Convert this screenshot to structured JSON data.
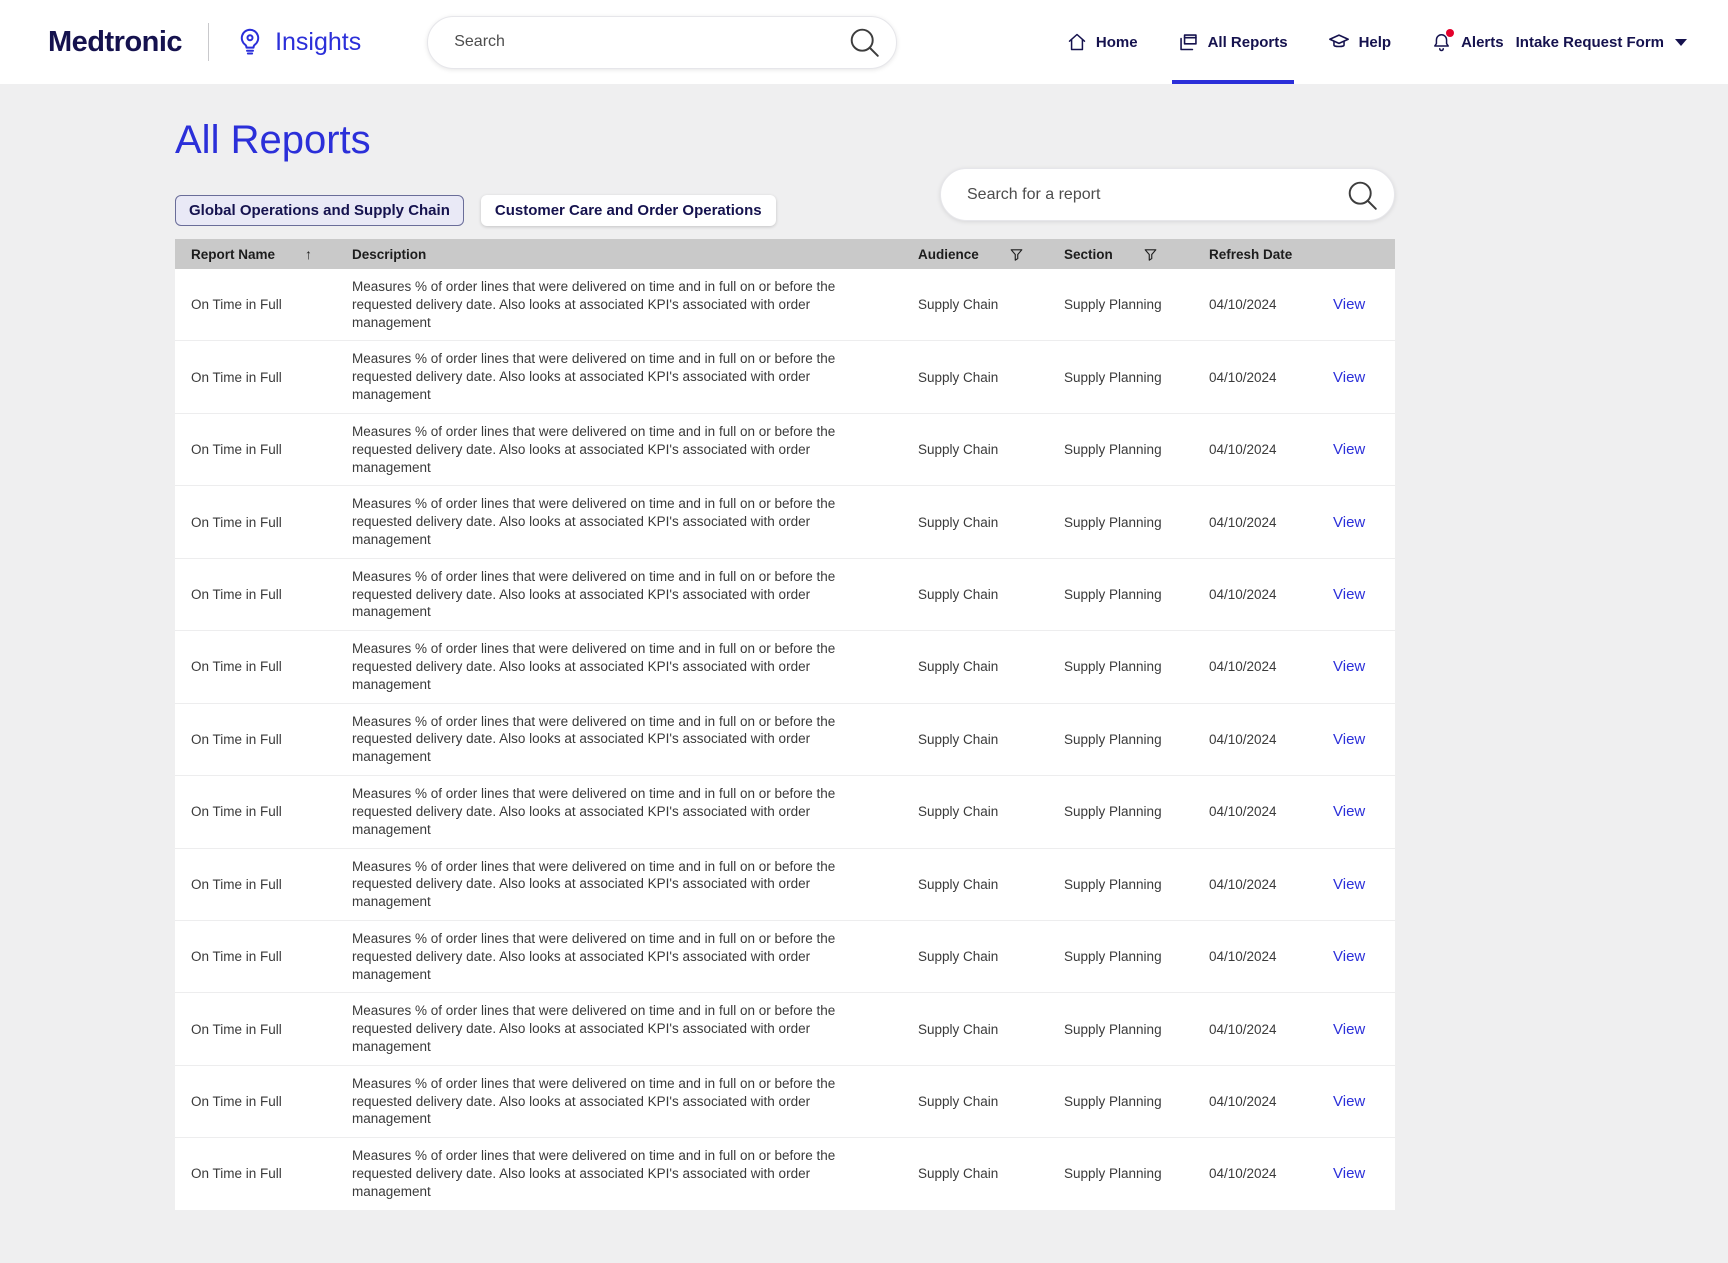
{
  "colors": {
    "accent": "#2b2fd9",
    "brand_navy": "#15124e",
    "page_bg": "#efeff0",
    "table_header_bg": "#c9c9c9",
    "alert_dot": "#e4002b",
    "link": "#2b2fd9"
  },
  "icons": {
    "brand": "lightbulb-icon",
    "header_search": "search-icon",
    "home": "home-icon",
    "all_reports": "reports-icon",
    "help": "graduation-cap-icon",
    "alerts": "bell-icon",
    "alerts_badge": "red-dot-badge",
    "intake_caret": "chevron-down-icon",
    "report_search": "search-icon",
    "sort": "arrow-up-icon",
    "filter": "funnel-icon"
  },
  "brand": {
    "wordmark": "Medtronic",
    "app_name": "Insights"
  },
  "header": {
    "search_placeholder": "Search",
    "nav": [
      {
        "label": "Home",
        "active": false
      },
      {
        "label": "All Reports",
        "active": true
      },
      {
        "label": "Help",
        "active": false
      },
      {
        "label": "Alerts",
        "active": false
      }
    ],
    "intake_label": "Intake Request Form"
  },
  "page": {
    "title": "All Reports",
    "report_search_placeholder": "Search for a report",
    "tabs": [
      {
        "label": "Global Operations and Supply Chain",
        "selected": true
      },
      {
        "label": "Customer Care and Order Operations",
        "selected": false
      }
    ]
  },
  "table": {
    "columns": [
      "Report Name",
      "Description",
      "Audience",
      "Section",
      "Refresh Date"
    ],
    "rows": [
      {
        "name": "On Time in Full",
        "description": "Measures % of order lines that were delivered on time and in full on or before the requested delivery date. Also looks at associated KPI's associated with order management",
        "audience": "Supply Chain",
        "section": "Supply Planning",
        "refresh_date": "04/10/2024",
        "action": "View"
      },
      {
        "name": "On Time in Full",
        "description": "Measures % of order lines that were delivered on time and in full on or before the requested delivery date. Also looks at associated KPI's associated with order management",
        "audience": "Supply Chain",
        "section": "Supply Planning",
        "refresh_date": "04/10/2024",
        "action": "View"
      },
      {
        "name": "On Time in Full",
        "description": "Measures % of order lines that were delivered on time and in full on or before the requested delivery date. Also looks at associated KPI's associated with order management",
        "audience": "Supply Chain",
        "section": "Supply Planning",
        "refresh_date": "04/10/2024",
        "action": "View"
      },
      {
        "name": "On Time in Full",
        "description": "Measures % of order lines that were delivered on time and in full on or before the requested delivery date. Also looks at associated KPI's associated with order management",
        "audience": "Supply Chain",
        "section": "Supply Planning",
        "refresh_date": "04/10/2024",
        "action": "View"
      },
      {
        "name": "On Time in Full",
        "description": "Measures % of order lines that were delivered on time and in full on or before the requested delivery date. Also looks at associated KPI's associated with order management",
        "audience": "Supply Chain",
        "section": "Supply Planning",
        "refresh_date": "04/10/2024",
        "action": "View"
      },
      {
        "name": "On Time in Full",
        "description": "Measures % of order lines that were delivered on time and in full on or before the requested delivery date. Also looks at associated KPI's associated with order management",
        "audience": "Supply Chain",
        "section": "Supply Planning",
        "refresh_date": "04/10/2024",
        "action": "View"
      },
      {
        "name": "On Time in Full",
        "description": "Measures % of order lines that were delivered on time and in full on or before the requested delivery date. Also looks at associated KPI's associated with order management",
        "audience": "Supply Chain",
        "section": "Supply Planning",
        "refresh_date": "04/10/2024",
        "action": "View"
      },
      {
        "name": "On Time in Full",
        "description": "Measures % of order lines that were delivered on time and in full on or before the requested delivery date. Also looks at associated KPI's associated with order management",
        "audience": "Supply Chain",
        "section": "Supply Planning",
        "refresh_date": "04/10/2024",
        "action": "View"
      },
      {
        "name": "On Time in Full",
        "description": "Measures % of order lines that were delivered on time and in full on or before the requested delivery date. Also looks at associated KPI's associated with order management",
        "audience": "Supply Chain",
        "section": "Supply Planning",
        "refresh_date": "04/10/2024",
        "action": "View"
      },
      {
        "name": "On Time in Full",
        "description": "Measures % of order lines that were delivered on time and in full on or before the requested delivery date. Also looks at associated KPI's associated with order management",
        "audience": "Supply Chain",
        "section": "Supply Planning",
        "refresh_date": "04/10/2024",
        "action": "View"
      },
      {
        "name": "On Time in Full",
        "description": "Measures % of order lines that were delivered on time and in full on or before the requested delivery date. Also looks at associated KPI's associated with order management",
        "audience": "Supply Chain",
        "section": "Supply Planning",
        "refresh_date": "04/10/2024",
        "action": "View"
      },
      {
        "name": "On Time in Full",
        "description": "Measures % of order lines that were delivered on time and in full on or before the requested delivery date. Also looks at associated KPI's associated with order management",
        "audience": "Supply Chain",
        "section": "Supply Planning",
        "refresh_date": "04/10/2024",
        "action": "View"
      },
      {
        "name": "On Time in Full",
        "description": "Measures % of order lines that were delivered on time and in full on or before the requested delivery date. Also looks at associated KPI's associated with order management",
        "audience": "Supply Chain",
        "section": "Supply Planning",
        "refresh_date": "04/10/2024",
        "action": "View"
      }
    ]
  }
}
